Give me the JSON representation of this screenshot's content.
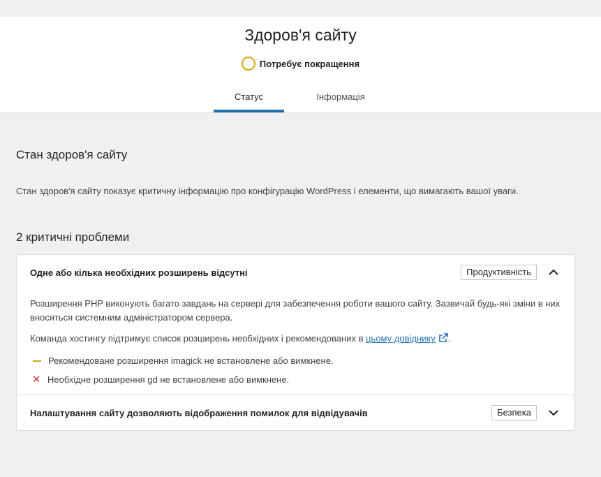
{
  "header": {
    "title": "Здоров'я сайту",
    "status_text": "Потребує покращення",
    "status_color": "#dba617",
    "tabs": [
      {
        "label": "Статус",
        "active": true
      },
      {
        "label": "Інформація",
        "active": false
      }
    ],
    "accent": "#2271b1"
  },
  "main": {
    "section_title": "Стан здоров'я сайту",
    "section_desc": "Стан здоров'я сайту показує критичну інформацію про конфігурацію WordPress і елементи, що вимагають вашої уваги.",
    "issues_title": "2 критичні проблеми",
    "issues": [
      {
        "title": "Одне або кілька необхідних розширень відсутні",
        "badge": "Продуктивність",
        "expanded": true,
        "body_p1": "Розширення PHP виконують багато завдань на сервері для забезпечення роботи вашого сайту. Зазвичай будь-які зміни в них вносяться системним адміністратором сервера.",
        "body_p2_prefix": "Команда хостингу підтримує список розширень необхідних і рекомендованих в",
        "body_p2_link": "цьому довіднику",
        "body_p2_suffix": ".",
        "items": [
          {
            "icon": "dash-icon",
            "color": "#dba617",
            "text": "Рекомендоване розширення imagick не встановлене або вимкнене."
          },
          {
            "icon": "x-icon",
            "color": "#d63638",
            "text": "Необхідне розширення gd не встановлене або вимкнене."
          }
        ]
      },
      {
        "title": "Налаштування сайту дозволяють відображення помилок для відвідувачів",
        "badge": "Безпека",
        "expanded": false
      }
    ]
  }
}
